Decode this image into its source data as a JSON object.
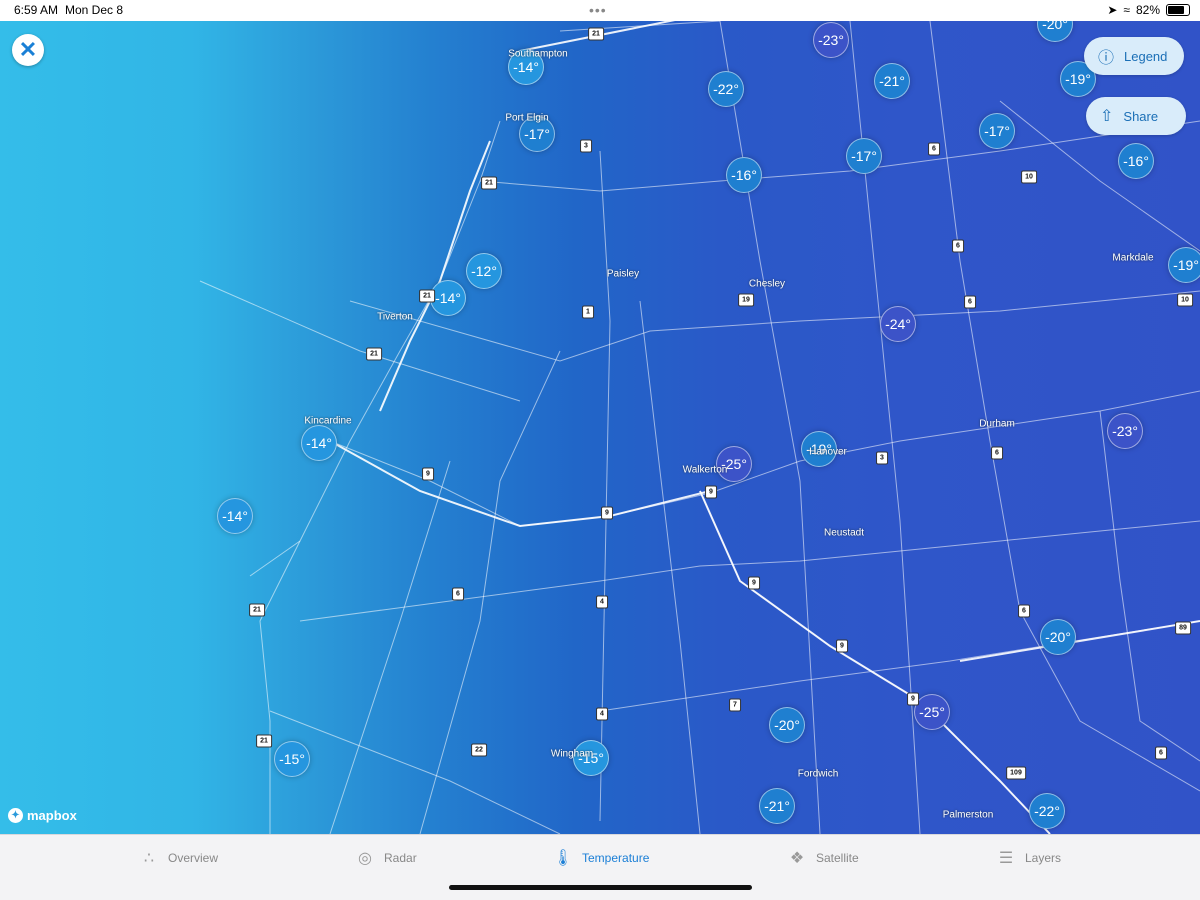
{
  "status_bar": {
    "time": "6:59 AM",
    "date": "Mon Dec 8",
    "dots": "•••",
    "battery": "82%",
    "battery_level": 0.82
  },
  "map": {
    "towns": [
      {
        "name": "Southampton"
      },
      {
        "name": "Port Elgin"
      },
      {
        "name": "Paisley"
      },
      {
        "name": "Chesley"
      },
      {
        "name": "Tiverton"
      },
      {
        "name": "Kincardine"
      },
      {
        "name": "Walkerton"
      },
      {
        "name": "Hanover"
      },
      {
        "name": "Durham"
      },
      {
        "name": "Neustadt"
      },
      {
        "name": "Markdale"
      },
      {
        "name": "Fordwich"
      },
      {
        "name": "Palmerston"
      },
      {
        "name": "Wingham"
      }
    ],
    "shields": [
      "21",
      "21",
      "3",
      "21",
      "10",
      "6",
      "6",
      "6",
      "19",
      "1",
      "21",
      "9",
      "9",
      "9",
      "9",
      "3",
      "6",
      "6",
      "6",
      "4",
      "9",
      "89",
      "9",
      "7",
      "4",
      "22",
      "21",
      "21",
      "109",
      "6",
      "10"
    ],
    "temperatures": [
      "-14°",
      "-17°",
      "-23°",
      "-22°",
      "-21°",
      "-20°",
      "-19°",
      "-17°",
      "-16°",
      "-17°",
      "-16°",
      "-12°",
      "-14°",
      "-24°",
      "-19°",
      "-14°",
      "-25°",
      "-19°",
      "-23°",
      "-14°",
      "-20°",
      "-20°",
      "-25°",
      "-15°",
      "-15°",
      "-21°",
      "-22°"
    ]
  },
  "buttons": {
    "legend": "Legend",
    "share": "Share"
  },
  "attribution": "mapbox",
  "tabs": [
    {
      "label": "Overview",
      "icon": "overview-icon"
    },
    {
      "label": "Radar",
      "icon": "radar-icon"
    },
    {
      "label": "Temperature",
      "icon": "thermometer-icon",
      "active": true
    },
    {
      "label": "Satellite",
      "icon": "satellite-icon"
    },
    {
      "label": "Layers",
      "icon": "layers-icon"
    }
  ]
}
